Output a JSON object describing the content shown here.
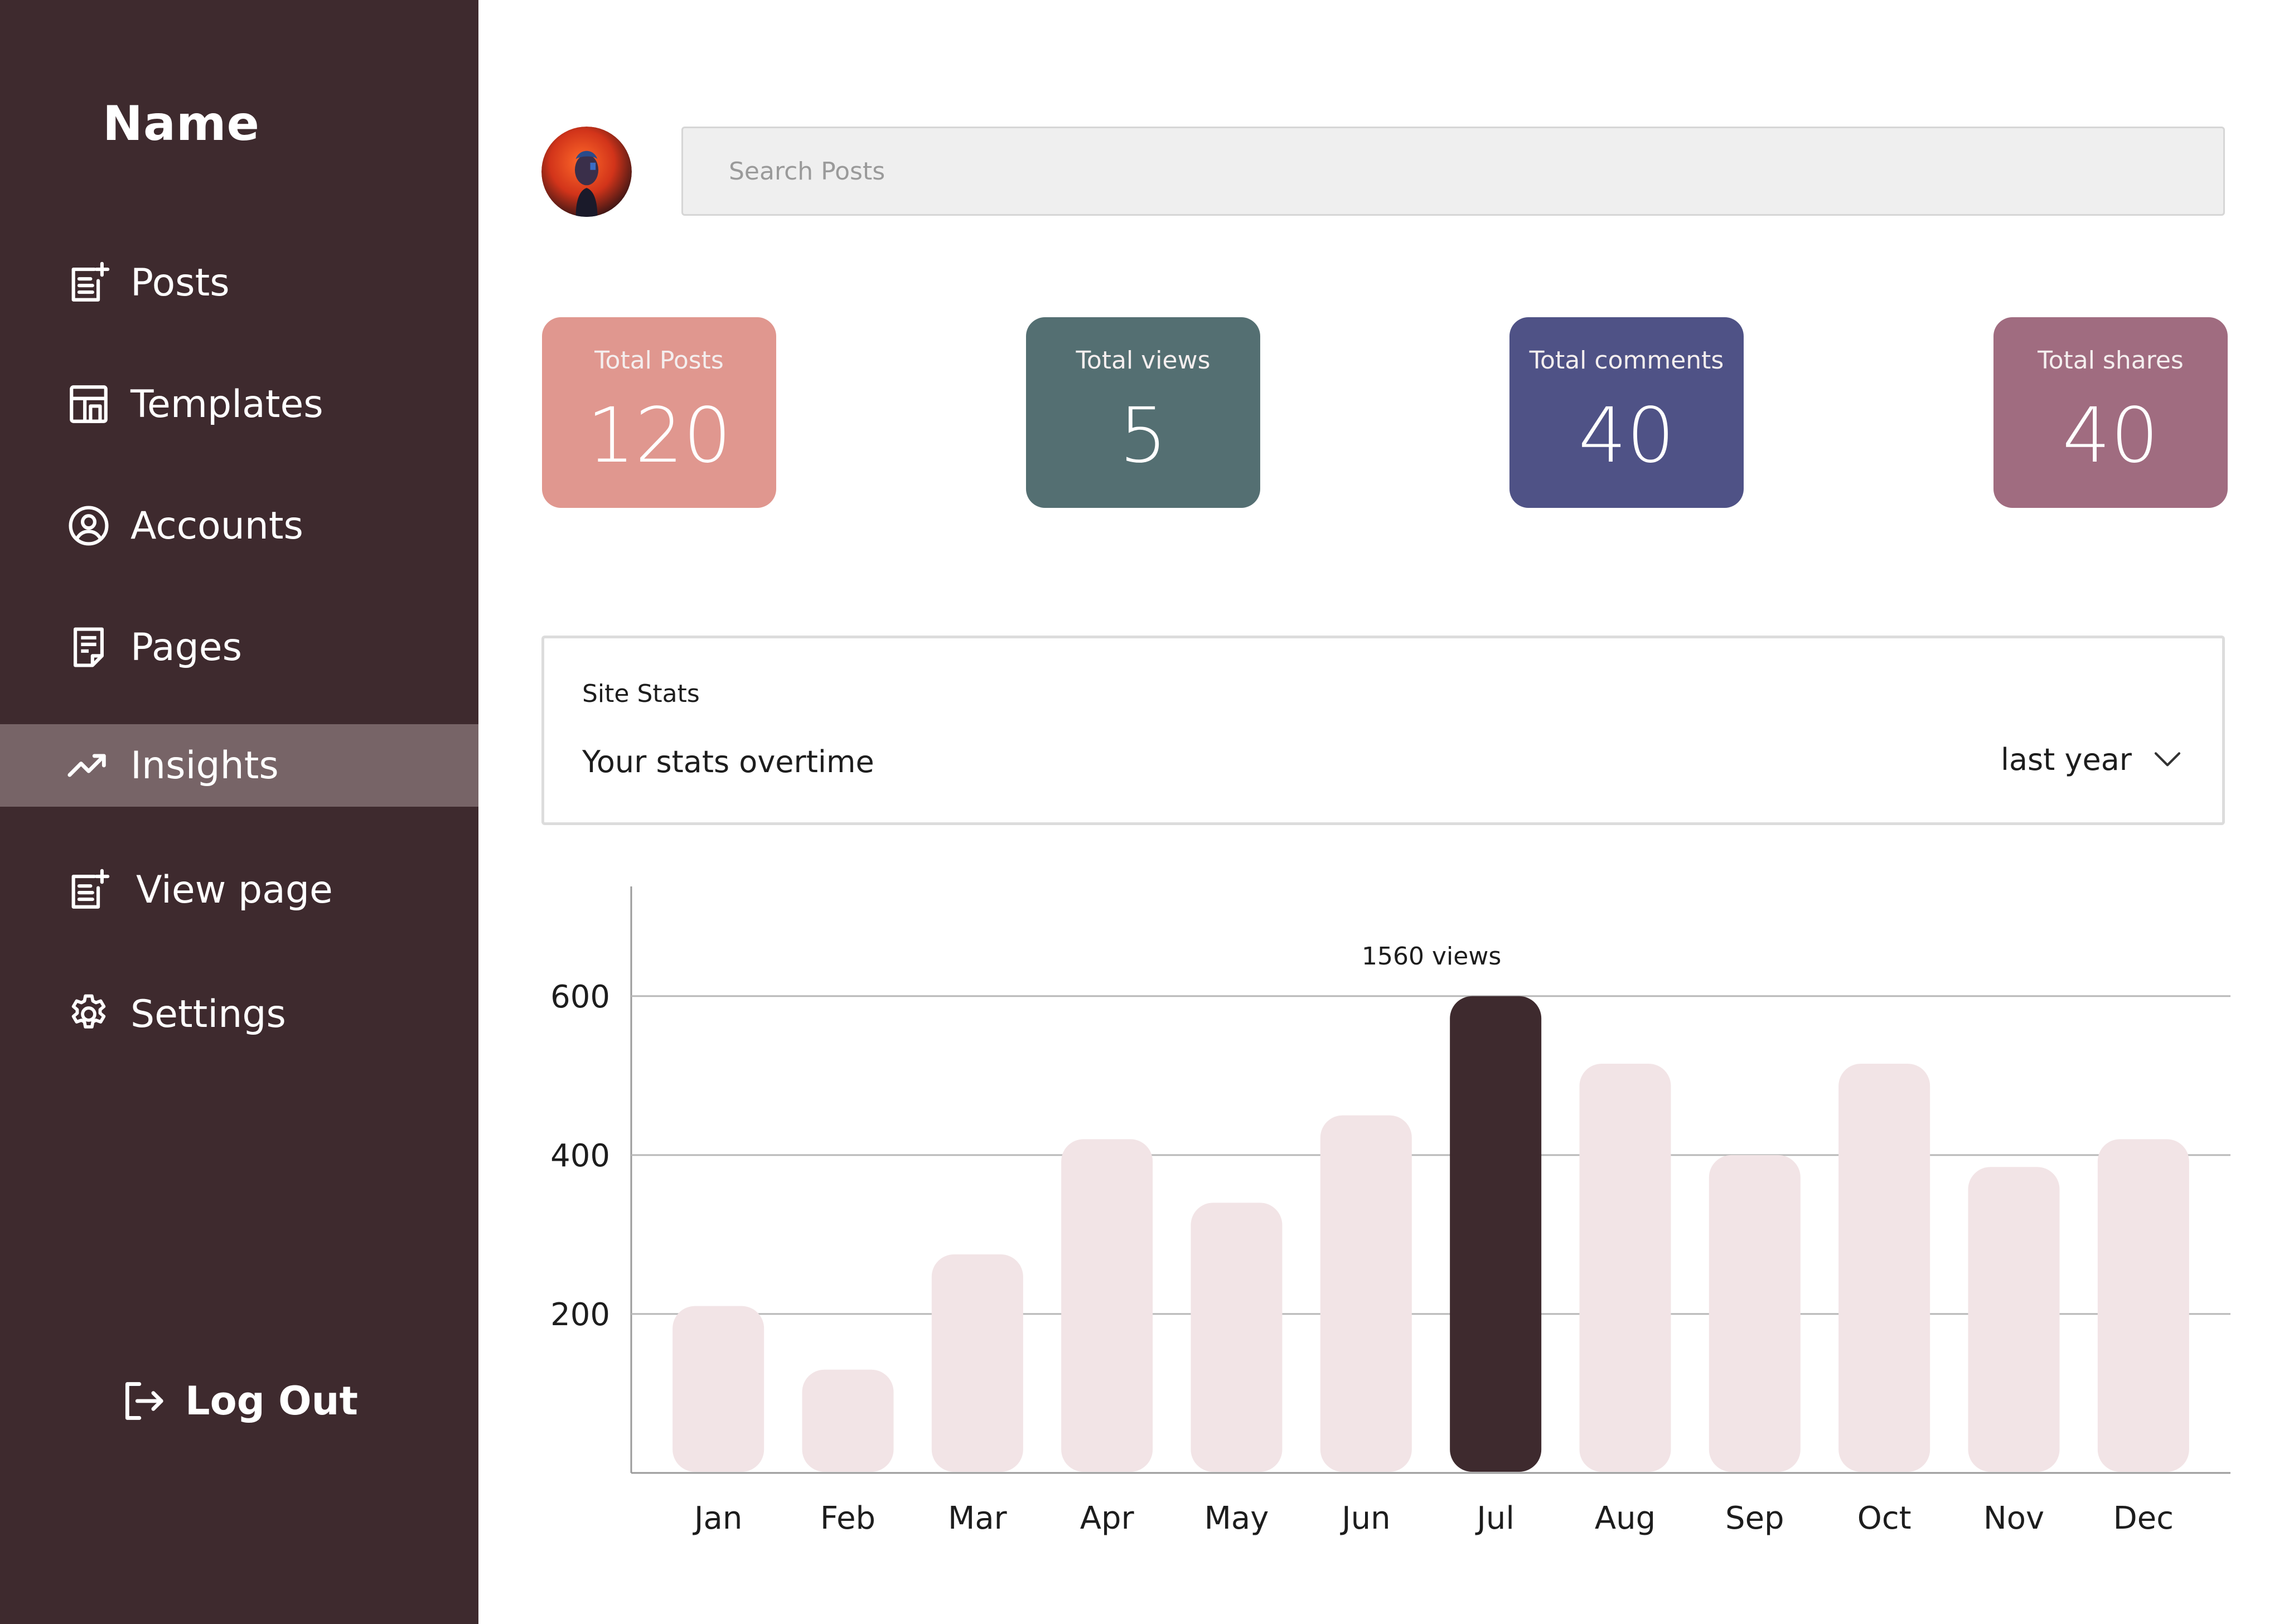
{
  "sidebar": {
    "brand": "Name",
    "items": [
      {
        "label": "Posts",
        "icon": "add-post-icon"
      },
      {
        "label": "Templates",
        "icon": "templates-icon"
      },
      {
        "label": "Accounts",
        "icon": "account-icon"
      },
      {
        "label": "Pages",
        "icon": "page-icon"
      },
      {
        "label": "Insights",
        "icon": "trending-up-icon",
        "active": true
      },
      {
        "label": "View page",
        "icon": "add-post-icon"
      },
      {
        "label": "Settings",
        "icon": "gear-icon"
      }
    ],
    "logout_label": "Log Out"
  },
  "header": {
    "search_placeholder": "Search Posts"
  },
  "stats": [
    {
      "label": "Total Posts",
      "value": "120",
      "color": "#e0978f"
    },
    {
      "label": "Total views",
      "value": "5",
      "color": "#546f72"
    },
    {
      "label": "Total comments",
      "value": "40",
      "color": "#4f5286"
    },
    {
      "label": "Total shares",
      "value": "40",
      "color": "#a06c80"
    }
  ],
  "site_stats": {
    "title": "Site Stats",
    "subtitle": "Your stats overtime",
    "period": "last year"
  },
  "colors": {
    "sidebar_bg": "#3e2a2e",
    "sidebar_active": "#776467",
    "bar": "#f2e4e6",
    "bar_highlight": "#3e2a2e"
  },
  "chart_data": {
    "type": "bar",
    "categories": [
      "Jan",
      "Feb",
      "Mar",
      "Apr",
      "May",
      "Jun",
      "Jul",
      "Aug",
      "Sep",
      "Oct",
      "Nov",
      "Dec"
    ],
    "values": [
      210,
      130,
      275,
      420,
      340,
      450,
      600,
      515,
      400,
      515,
      385,
      420
    ],
    "highlight_index": 6,
    "annotation": "1560 views",
    "yticks": [
      200,
      400,
      600
    ],
    "ylim": [
      0,
      710
    ],
    "grid": true
  }
}
